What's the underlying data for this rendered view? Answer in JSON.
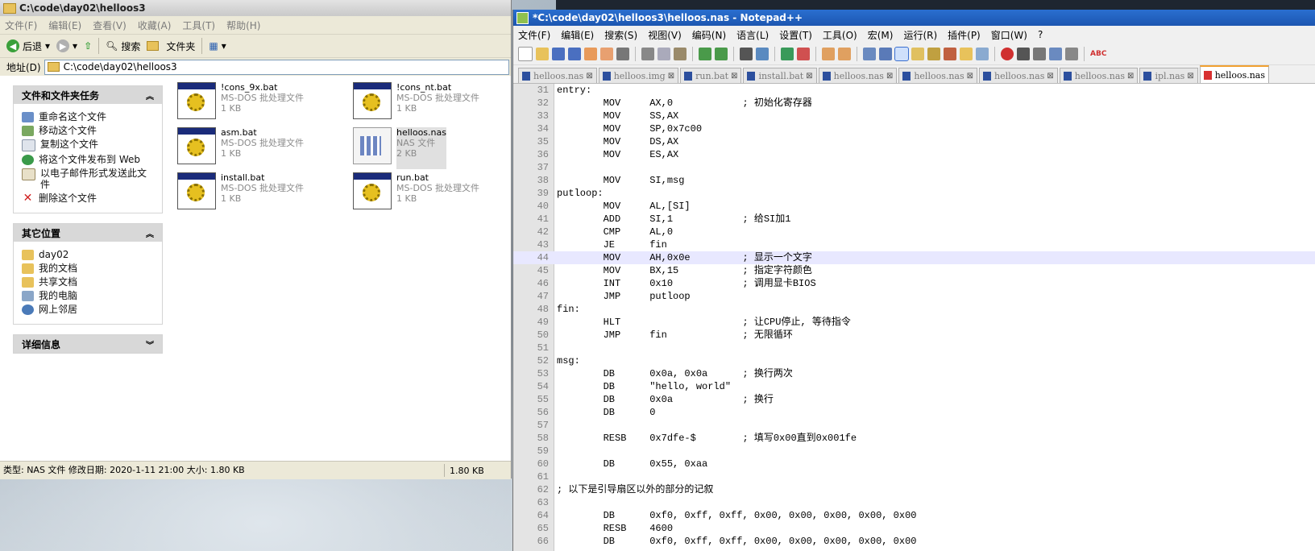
{
  "explorer": {
    "title": "C:\\code\\day02\\helloos3",
    "menu": [
      "文件(F)",
      "编辑(E)",
      "查看(V)",
      "收藏(A)",
      "工具(T)",
      "帮助(H)"
    ],
    "toolbar": {
      "back": "后退",
      "search": "搜索",
      "folders": "文件夹"
    },
    "address_label": "地址(D)",
    "address_value": "C:\\code\\day02\\helloos3",
    "task_groups": [
      {
        "title": "文件和文件夹任务",
        "items": [
          "重命名这个文件",
          "移动这个文件",
          "复制这个文件",
          "将这个文件发布到 Web",
          "以电子邮件形式发送此文件",
          "删除这个文件"
        ]
      },
      {
        "title": "其它位置",
        "items": [
          "day02",
          "我的文档",
          "共享文档",
          "我的电脑",
          "网上邻居"
        ]
      },
      {
        "title": "详细信息",
        "items": []
      }
    ],
    "files": [
      {
        "name": "!cons_9x.bat",
        "type": "MS-DOS 批处理文件",
        "size": "1 KB"
      },
      {
        "name": "!cons_nt.bat",
        "type": "MS-DOS 批处理文件",
        "size": "1 KB"
      },
      {
        "name": "asm.bat",
        "type": "MS-DOS 批处理文件",
        "size": "1 KB"
      },
      {
        "name": "helloos.nas",
        "type": "NAS 文件",
        "size": "2 KB"
      },
      {
        "name": "install.bat",
        "type": "MS-DOS 批处理文件",
        "size": "1 KB"
      },
      {
        "name": "run.bat",
        "type": "MS-DOS 批处理文件",
        "size": "1 KB"
      }
    ],
    "status_main": "类型: NAS 文件 修改日期: 2020-1-11 21:00 大小: 1.80 KB",
    "status_size": "1.80 KB"
  },
  "npp": {
    "title": "*C:\\code\\day02\\helloos3\\helloos.nas - Notepad++",
    "menu": [
      "文件(F)",
      "编辑(E)",
      "搜索(S)",
      "视图(V)",
      "编码(N)",
      "语言(L)",
      "设置(T)",
      "工具(O)",
      "宏(M)",
      "运行(R)",
      "插件(P)",
      "窗口(W)",
      "?"
    ],
    "tabs": [
      "helloos.nas",
      "helloos.img",
      "run.bat",
      "install.bat",
      "helloos.nas",
      "helloos.nas",
      "helloos.nas",
      "helloos.nas",
      "ipl.nas",
      "helloos.nas"
    ],
    "active_tab": 9,
    "current_line": 44,
    "lines": [
      {
        "n": "31",
        "t": "entry:"
      },
      {
        "n": "32",
        "t": "        MOV     AX,0            ; 初始化寄存器"
      },
      {
        "n": "33",
        "t": "        MOV     SS,AX"
      },
      {
        "n": "34",
        "t": "        MOV     SP,0x7c00"
      },
      {
        "n": "35",
        "t": "        MOV     DS,AX"
      },
      {
        "n": "36",
        "t": "        MOV     ES,AX"
      },
      {
        "n": "37",
        "t": ""
      },
      {
        "n": "38",
        "t": "        MOV     SI,msg"
      },
      {
        "n": "39",
        "t": "putloop:"
      },
      {
        "n": "40",
        "t": "        MOV     AL,[SI]"
      },
      {
        "n": "41",
        "t": "        ADD     SI,1            ; 给SI加1"
      },
      {
        "n": "42",
        "t": "        CMP     AL,0"
      },
      {
        "n": "43",
        "t": "        JE      fin"
      },
      {
        "n": "44",
        "t": "        MOV     AH,0x0e         ; 显示一个文字"
      },
      {
        "n": "45",
        "t": "        MOV     BX,15           ; 指定字符颜色"
      },
      {
        "n": "46",
        "t": "        INT     0x10            ; 调用显卡BIOS"
      },
      {
        "n": "47",
        "t": "        JMP     putloop"
      },
      {
        "n": "48",
        "t": "fin:"
      },
      {
        "n": "49",
        "t": "        HLT                     ; 让CPU停止, 等待指令"
      },
      {
        "n": "50",
        "t": "        JMP     fin             ; 无限循环"
      },
      {
        "n": "51",
        "t": ""
      },
      {
        "n": "52",
        "t": "msg:"
      },
      {
        "n": "53",
        "t": "        DB      0x0a, 0x0a      ; 换行两次"
      },
      {
        "n": "54",
        "t": "        DB      \"hello, world\""
      },
      {
        "n": "55",
        "t": "        DB      0x0a            ; 换行"
      },
      {
        "n": "56",
        "t": "        DB      0"
      },
      {
        "n": "57",
        "t": ""
      },
      {
        "n": "58",
        "t": "        RESB    0x7dfe-$        ; 填写0x00直到0x001fe"
      },
      {
        "n": "59",
        "t": ""
      },
      {
        "n": "60",
        "t": "        DB      0x55, 0xaa"
      },
      {
        "n": "61",
        "t": ""
      },
      {
        "n": "62",
        "t": "; 以下是引导扇区以外的部分的记叙"
      },
      {
        "n": "63",
        "t": ""
      },
      {
        "n": "64",
        "t": "        DB      0xf0, 0xff, 0xff, 0x00, 0x00, 0x00, 0x00, 0x00"
      },
      {
        "n": "65",
        "t": "        RESB    4600"
      },
      {
        "n": "66",
        "t": "        DB      0xf0, 0xff, 0xff, 0x00, 0x00, 0x00, 0x00, 0x00"
      }
    ]
  }
}
